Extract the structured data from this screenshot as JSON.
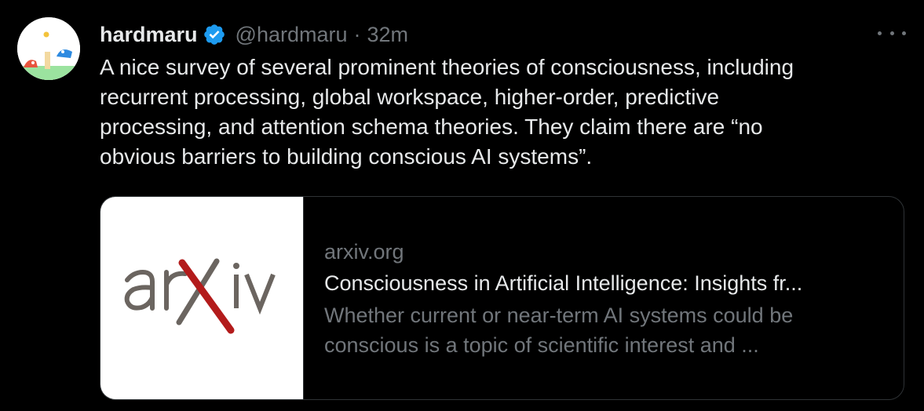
{
  "tweet": {
    "display_name": "hardmaru",
    "handle": "@hardmaru",
    "separator": "·",
    "time": "32m",
    "text_lines": [
      "A nice survey of several prominent theories of consciousness, including",
      "recurrent processing, global workspace, higher-order, predictive",
      "processing, and attention schema theories. They claim there are “no",
      "obvious barriers to building conscious AI systems”."
    ]
  },
  "card": {
    "logo_text": "arXiv",
    "domain": "arxiv.org",
    "title": "Consciousness in Artificial Intelligence: Insights fr...",
    "description_lines": [
      "Whether current or near-term AI systems could be",
      "conscious is a topic of scientific interest and ..."
    ]
  },
  "icons": {
    "verified": "verified-badge-icon",
    "more": "more-options-icon"
  },
  "colors": {
    "background": "#000000",
    "primary_text": "#e7e9ea",
    "secondary_text": "#71767b",
    "verified_blue": "#1d9bf0",
    "border": "#2f3336",
    "arxiv_red": "#b31b1b",
    "arxiv_gray": "#6b6560"
  }
}
